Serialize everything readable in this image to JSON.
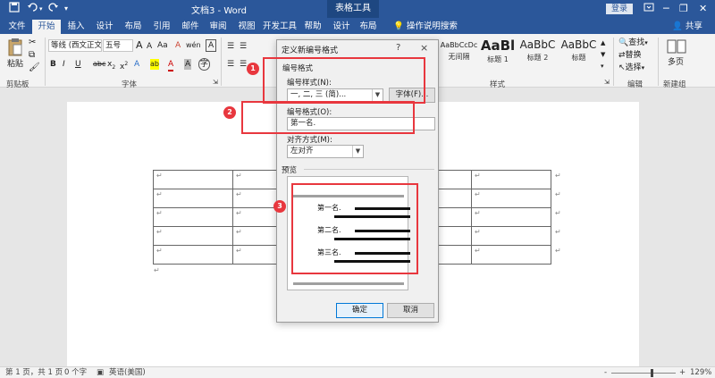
{
  "titlebar": {
    "save_icon": "save-icon",
    "undo_icon": "undo-icon",
    "redo_icon": "redo-icon",
    "customize_icon": "customize-quick-access-icon",
    "doc_title": "文档3 - Word",
    "context_tab": "表格工具",
    "login": "登录",
    "ribbon_options_icon": "ribbon-display-options-icon",
    "minimize_icon": "minimize-icon",
    "restore_icon": "restore-icon",
    "close_icon": "close-icon"
  },
  "tabs": [
    {
      "label": "文件"
    },
    {
      "label": "开始"
    },
    {
      "label": "插入"
    },
    {
      "label": "设计"
    },
    {
      "label": "布局"
    },
    {
      "label": "引用"
    },
    {
      "label": "邮件"
    },
    {
      "label": "审阅"
    },
    {
      "label": "视图"
    },
    {
      "label": "开发工具"
    },
    {
      "label": "帮助"
    },
    {
      "label": "设计"
    },
    {
      "label": "布局"
    }
  ],
  "tellme": "操作说明搜索",
  "share": "共享",
  "ribbon": {
    "paste_label": "粘贴",
    "clipboard_label": "剪贴板",
    "font_label": "字体",
    "styles_label": "样式",
    "editing_label": "编辑",
    "new_group_label": "新建组",
    "font_name": "等线 (西文正文)",
    "font_size": "五号",
    "grow_font": "A",
    "shrink_font": "A",
    "change_case": "Aa",
    "clear_format": "A",
    "wen_label": "wén",
    "char_border": "A",
    "bold": "B",
    "italic": "I",
    "underline": "U",
    "strike": "abc",
    "subscript": "x",
    "superscript": "x",
    "text_effect": "A",
    "highlight": "ab",
    "font_color": "A",
    "char_shade": "A",
    "enclose": "字",
    "styles": [
      {
        "sample": "AaBbCcDc",
        "name": "无间隔"
      },
      {
        "sample": "AaBl",
        "name": "标题 1"
      },
      {
        "sample": "AaBbC",
        "name": "标题 2"
      },
      {
        "sample": "AaBbC",
        "name": "标题"
      }
    ],
    "find": "查找",
    "replace": "替换",
    "select": "选择",
    "multipage": "多页",
    "accent_color": "#2b579a"
  },
  "dialog": {
    "title": "定义新编号格式",
    "help": "?",
    "close": "×",
    "section_number_format": "编号格式",
    "number_style_label": "编号样式(N):",
    "number_style_value": "一, 二, 三 (简)...",
    "font_button": "字体(F)...",
    "number_format_label": "编号格式(O):",
    "number_format_value": "第一名.",
    "alignment_label": "对齐方式(M):",
    "alignment_value": "左对齐",
    "preview_label": "预览",
    "preview_items": [
      "第一名.",
      "第二名.",
      "第三名."
    ],
    "ok": "确定",
    "cancel": "取消"
  },
  "annotations": {
    "badges": [
      "1",
      "2",
      "3"
    ],
    "color": "#e8373e"
  },
  "document": {
    "cell_mark": "↵",
    "para_mark": "↵",
    "rows": 5,
    "cols": 5
  },
  "status": {
    "page": "第 1 页，共 1 页",
    "words": "0 个字",
    "proofing_icon": "proofing-icon",
    "language": "英语(美国)",
    "zoom_minus": "-",
    "zoom_plus": "+",
    "zoom": "129%"
  }
}
